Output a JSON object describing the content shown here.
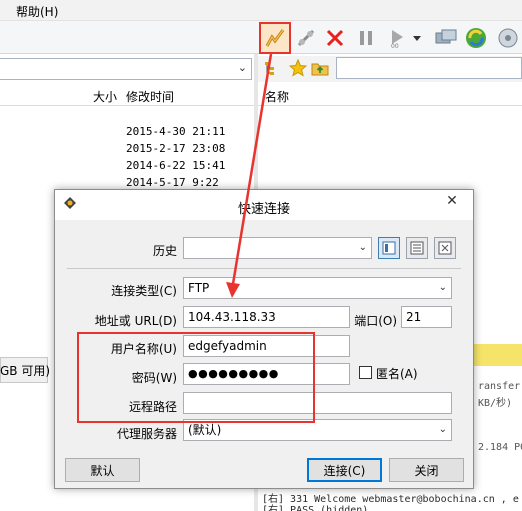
{
  "menubar": {
    "help": "帮助(H)"
  },
  "toolbar": {
    "icons": [
      "quick-connect-icon",
      "connect-icon",
      "disconnect-icon",
      "pause-icon",
      "play-icon",
      "dropdown-icon",
      "transfer-queue-icon",
      "refresh-icon"
    ],
    "highlight_color": "#e8342f"
  },
  "left_pane": {
    "path_value": "",
    "columns": [
      "大小",
      "修改时间"
    ],
    "dates": [
      "2015-4-30 21:11",
      "2015-2-17 23:08",
      "2014-6-22 15:41",
      "2014-5-17 9:22"
    ],
    "free_space": "GB 可用)"
  },
  "right_pane": {
    "columns": [
      "名称"
    ],
    "log_lines": [
      "ransfer",
      "KB/秒)",
      "2.184 PO",
      "[右] 331 Welcome  webmaster@bobochina.cn , e",
      "[右] PASS (hidden)"
    ]
  },
  "dialog": {
    "title": "快速连接",
    "history_label": "历史",
    "history_value": "",
    "conn_type_label": "连接类型(C)",
    "conn_type_value": "FTP",
    "address_label": "地址或 URL(D)",
    "address_value": "104.43.118.33",
    "port_label": "端口(O)",
    "port_value": "21",
    "user_label": "用户名称(U)",
    "user_value": "edgefyadmin",
    "anonymous_label": "匿名(A)",
    "password_label": "密码(W)",
    "password_value": "●●●●●●●●●",
    "remote_path_label": "远程路径",
    "remote_path_value": "",
    "proxy_label": "代理服务器",
    "proxy_value": "(默认)",
    "default_button": "默认",
    "connect_button": "连接(C)",
    "close_button": "关闭"
  }
}
